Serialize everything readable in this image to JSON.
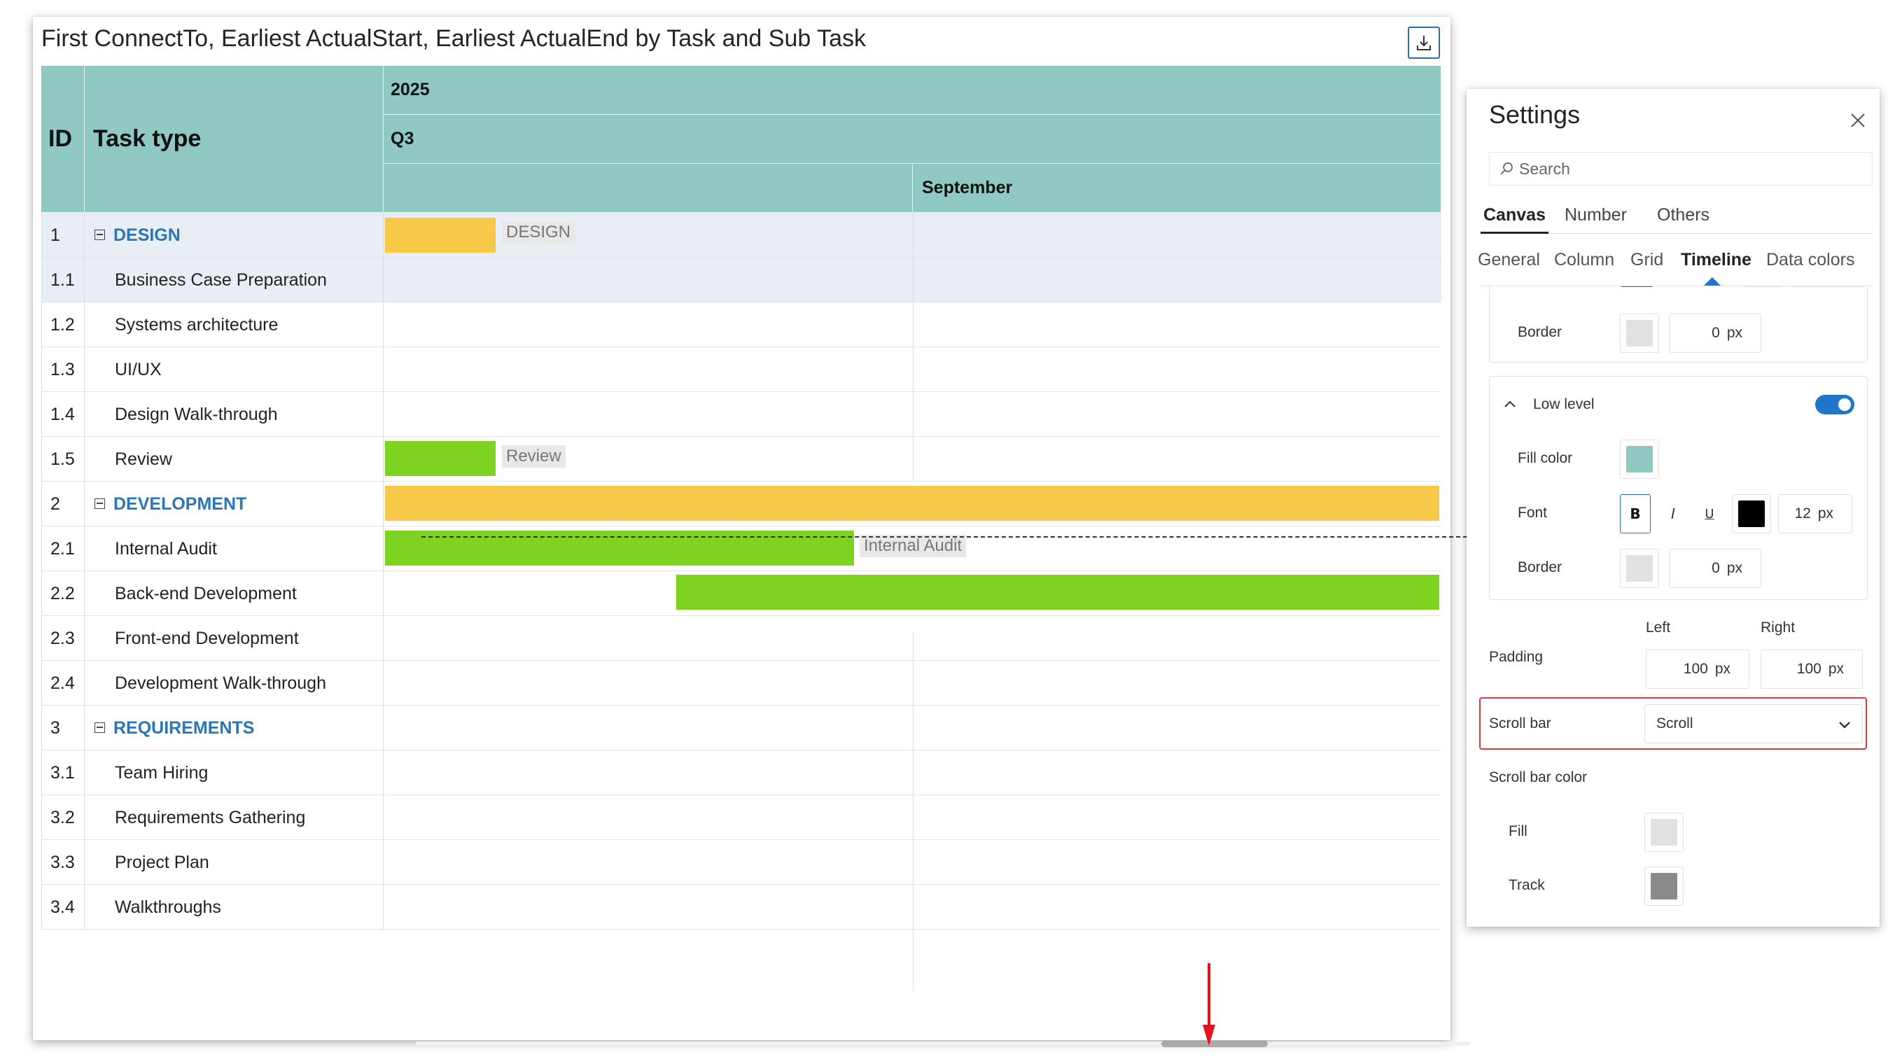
{
  "visual": {
    "title": "First ConnectTo, Earliest ActualStart, Earliest ActualEnd by Task and Sub Task",
    "export_icon": "export-icon",
    "header": {
      "id": "ID",
      "task_type": "Task type",
      "year": "2025",
      "quarter": "Q3",
      "month": "September"
    },
    "rows": [
      {
        "id": "1",
        "task": "DESIGN",
        "group": true
      },
      {
        "id": "1.1",
        "task": "Business Case Preparation",
        "group": false
      },
      {
        "id": "1.2",
        "task": "Systems architecture",
        "group": false
      },
      {
        "id": "1.3",
        "task": "UI/UX",
        "group": false
      },
      {
        "id": "1.4",
        "task": "Design Walk-through",
        "group": false
      },
      {
        "id": "1.5",
        "task": "Review",
        "group": false
      },
      {
        "id": "2",
        "task": "DEVELOPMENT",
        "group": true
      },
      {
        "id": "2.1",
        "task": "Internal Audit",
        "group": false
      },
      {
        "id": "2.2",
        "task": "Back-end Development",
        "group": false
      },
      {
        "id": "2.3",
        "task": "Front-end Development",
        "group": false
      },
      {
        "id": "2.4",
        "task": "Development Walk-through",
        "group": false
      },
      {
        "id": "3",
        "task": "REQUIREMENTS",
        "group": true
      },
      {
        "id": "3.1",
        "task": "Team Hiring",
        "group": false
      },
      {
        "id": "3.2",
        "task": "Requirements Gathering",
        "group": false
      },
      {
        "id": "3.3",
        "task": "Project Plan",
        "group": false
      },
      {
        "id": "3.4",
        "task": "Walkthroughs",
        "group": false
      }
    ],
    "bar_labels": {
      "design": "DESIGN",
      "review": "Review",
      "internal_audit": "Internal Audit"
    },
    "colors": {
      "header_fill": "#8fc9c1",
      "group_bar": "#f8c949",
      "task_bar": "#7ed321",
      "group_text": "#2a76b6",
      "highlight_row": "#e9eef4",
      "arrow": "#e8101a"
    }
  },
  "settings": {
    "title": "Settings",
    "close_icon": "close-icon",
    "search_placeholder": "Search",
    "main_tabs": [
      "Canvas",
      "Number",
      "Others"
    ],
    "active_main_tab": "Canvas",
    "sub_tabs": [
      "General",
      "Column",
      "Grid",
      "Timeline",
      "Data colors"
    ],
    "active_sub_tab": "Timeline",
    "top_group": {
      "border_label": "Border",
      "border_value": "0",
      "unit": "px"
    },
    "low_level": {
      "title": "Low level",
      "enabled": true,
      "fill_color_label": "Fill color",
      "fill_color": "#8fc9c1",
      "font_label": "Font",
      "bold": "B",
      "italic": "I",
      "underline": "U",
      "font_color": "#000000",
      "font_size": "12",
      "unit": "px",
      "border_label": "Border",
      "border_value": "0"
    },
    "padding": {
      "label": "Padding",
      "left_label": "Left",
      "right_label": "Right",
      "left_value": "100",
      "right_value": "100",
      "unit": "px"
    },
    "scroll_bar": {
      "label": "Scroll bar",
      "value": "Scroll"
    },
    "scroll_bar_color": {
      "label": "Scroll bar color",
      "fill_label": "Fill",
      "fill_color": "#e1e1e1",
      "track_label": "Track",
      "track_color": "#8a8a8a",
      "highlight_frame_color": "#e0393e"
    }
  }
}
